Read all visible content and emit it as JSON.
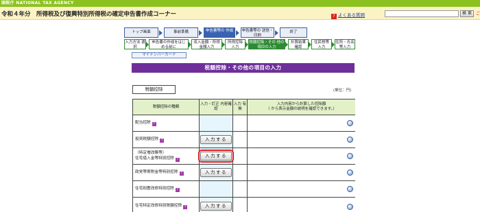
{
  "agency_bar": {
    "text": "国税庁 NATIONAL TAX AGENCY"
  },
  "header": {
    "title": "令和４年分　所得税及び復興特別所得税の確定申告書作成コーナー",
    "faq_label": "よくある質問",
    "search_value": "",
    "search_button": "検 索",
    "help_label": "ご利"
  },
  "steps": [
    {
      "label": "トップ画面"
    },
    {
      "label": "事前準備"
    },
    {
      "label": "申告書等の 作成"
    },
    {
      "label": "申告書等の 送信・印刷"
    },
    {
      "label": "終了"
    }
  ],
  "substeps": [
    {
      "label": "入力方法 選択"
    },
    {
      "label": "申告書の作成をはじ める前に"
    },
    {
      "label": "収入金額・所得 金額入力"
    },
    {
      "label": "所得控除 入力"
    },
    {
      "label": "税額控除・その 他の項目の入力"
    },
    {
      "label": "計算結果 確認"
    },
    {
      "label": "住民税等 入力"
    },
    {
      "label": "住所・氏名 等入力"
    }
  ],
  "mynumber_label": "マイナンバーカード",
  "section_title": "税額控除・その他の項目の入力",
  "tab_label": "税額控除",
  "unit_label": "(単位：円)",
  "table": {
    "headers": {
      "type": "税額控除の種類",
      "edit": "入力・訂正 内容確認",
      "has": "入力 有無",
      "amount_line1": "入力内容から計算した控除額",
      "amount_line2": "（ から表示金額の説明を確認できます。）"
    },
    "rows": [
      {
        "name": "配当控除",
        "button": ""
      },
      {
        "name": "投資税額控除",
        "button": "入力する"
      },
      {
        "name_line1": "（特定増改築等）",
        "name_line2": "住宅借入金等特別控除",
        "button": "入力する"
      },
      {
        "name": "政党等寄附金等特別控除",
        "button": "入力する"
      },
      {
        "name": "住宅耐震改修特別控除",
        "button": ""
      },
      {
        "name": "住宅特定改修特別税額控除",
        "button": "入力する"
      }
    ]
  },
  "colors": {
    "accent_green": "#8cc21f",
    "header_purple": "#6e2f9a",
    "highlight_red": "#e02020"
  }
}
